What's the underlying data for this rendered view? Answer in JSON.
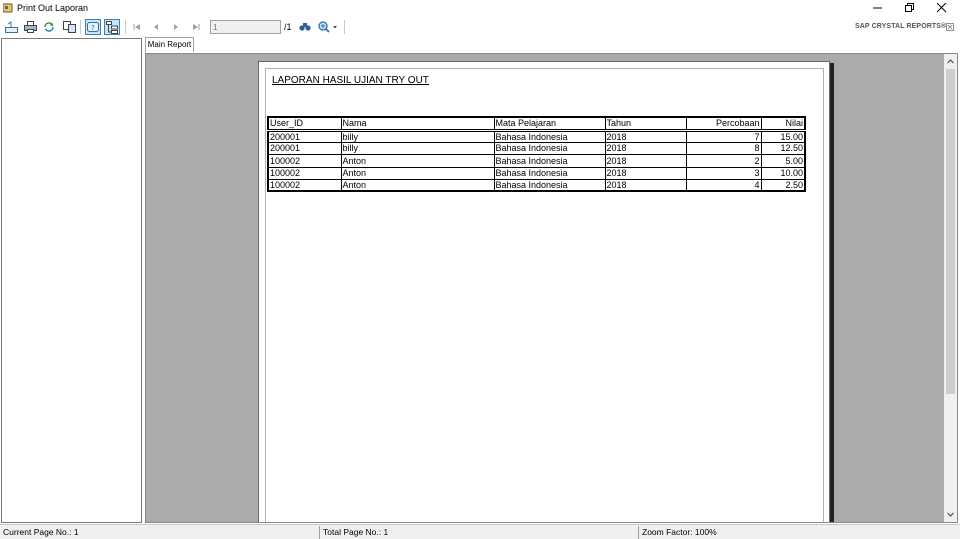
{
  "window": {
    "title": "Print Out Laporan"
  },
  "toolbar": {
    "page_input_value": "1",
    "page_total": "/1",
    "brand": "SAP CRYSTAL REPORTS®",
    "icons": [
      "export-icon",
      "print-icon",
      "refresh-icon",
      "copy-icon",
      "help-icon",
      "group-tree-icon",
      "first-page-icon",
      "prev-page-icon",
      "next-page-icon",
      "last-page-icon",
      "find-icon",
      "zoom-icon"
    ]
  },
  "tabs": [
    {
      "label": "Main Report"
    }
  ],
  "report": {
    "title": "LAPORAN HASIL UJIAN TRY OUT",
    "columns": [
      "User_ID",
      "Nama",
      "Mata Pelajaran",
      "Tahun",
      "Percobaan",
      "Nilai"
    ],
    "rows": [
      [
        "200001",
        "billy",
        "Bahasa Indonesia",
        "2018",
        "7",
        "15.00"
      ],
      [
        "200001",
        "billy",
        "Bahasa Indonesia",
        "2018",
        "8",
        "12.50"
      ],
      [
        "100002",
        "Anton",
        "Bahasa Indonesia",
        "2018",
        "2",
        "5.00"
      ],
      [
        "100002",
        "Anton",
        "Bahasa Indonesia",
        "2018",
        "3",
        "10.00"
      ],
      [
        "100002",
        "Anton",
        "Bahasa Indonesia",
        "2018",
        "4",
        "2.50"
      ]
    ]
  },
  "status": {
    "current_page": "Current Page No.: 1",
    "total_page": "Total Page No.: 1",
    "zoom": "Zoom Factor: 100%"
  },
  "colors": {
    "viewer_background": "#ababab",
    "active_button": "#cce4f7"
  }
}
